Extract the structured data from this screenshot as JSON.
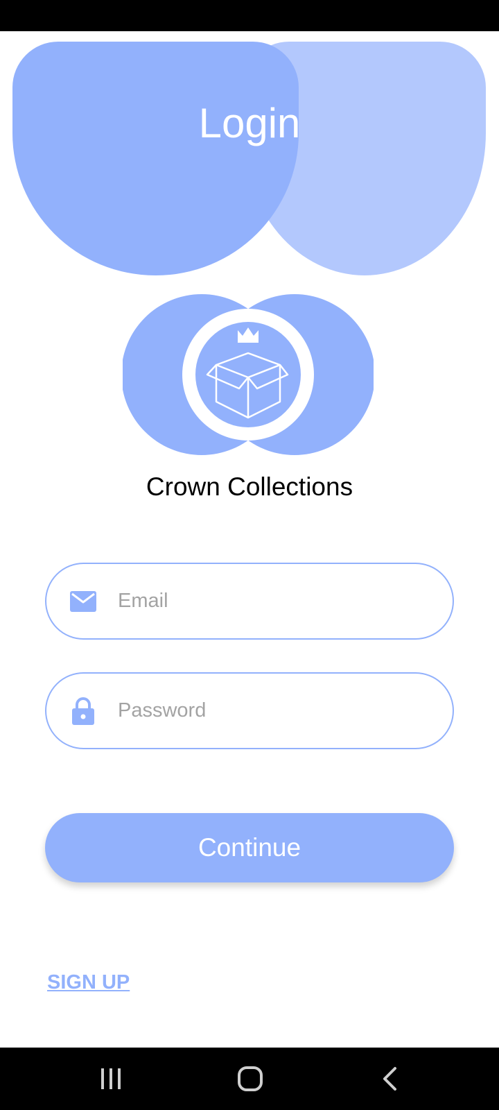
{
  "header": {
    "title": "Login"
  },
  "brand": {
    "name": "Crown Collections",
    "logo_icon": "crown-box-logo"
  },
  "form": {
    "email": {
      "icon": "mail-icon",
      "placeholder": "Email",
      "value": ""
    },
    "password": {
      "icon": "lock-icon",
      "placeholder": "Password",
      "value": ""
    },
    "continue_label": "Continue",
    "signup_label": "SIGN UP"
  },
  "nav": {
    "recents_icon": "recents-icon",
    "home_icon": "home-icon",
    "back_icon": "back-icon"
  },
  "colors": {
    "accent": "#92b1fc",
    "accent_light": "#b3c8fd",
    "placeholder": "#a3a3a3",
    "system_bars": "#000000"
  }
}
